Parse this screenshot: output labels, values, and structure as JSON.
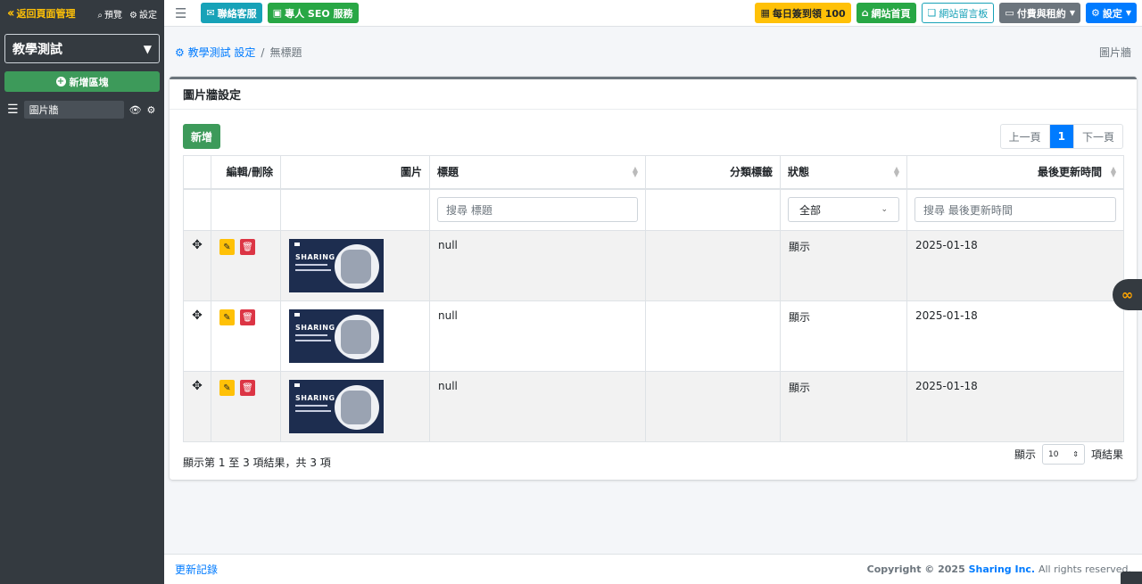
{
  "sidebar": {
    "back_label": "返回頁面管理",
    "preview_label": "預覽",
    "settings_label": "設定",
    "site_select": "教學測試",
    "add_block_label": "新增區塊",
    "items": [
      {
        "label": "圖片牆"
      }
    ]
  },
  "topbar": {
    "contact_label": "聯絡客服",
    "seo_label": "專人 SEO 服務",
    "checkin_label": "每日簽到領 100",
    "home_label": "網站首頁",
    "board_label": "網站留言板",
    "pay_label": "付費與租約",
    "settings_label": "設定"
  },
  "breadcrumb": {
    "root": "教學測試 設定",
    "current": "無標題",
    "right": "圖片牆"
  },
  "card": {
    "title": "圖片牆設定",
    "add_button": "新增",
    "pager": {
      "prev": "上一頁",
      "page": "1",
      "next": "下一頁"
    },
    "columns": [
      "編輯/刪除",
      "圖片",
      "標題",
      "分類標籤",
      "狀態",
      "最後更新時間"
    ],
    "filters": {
      "title_placeholder": "搜尋 標題",
      "status_value": "全部",
      "updated_placeholder": "搜尋 最後更新時間"
    },
    "rows": [
      {
        "image_text": "SHARING",
        "title": "null",
        "tag": "",
        "status": "顯示",
        "updated": "2025-01-18"
      },
      {
        "image_text": "SHARING",
        "title": "null",
        "tag": "",
        "status": "顯示",
        "updated": "2025-01-18"
      },
      {
        "image_text": "SHARING",
        "title": "null",
        "tag": "",
        "status": "顯示",
        "updated": "2025-01-18"
      }
    ],
    "summary": "顯示第 1 至 3 項結果，共 3 項",
    "length_prefix": "顯示",
    "length_value": "10",
    "length_suffix": "項結果"
  },
  "footer": {
    "changelog_label": "更新記錄",
    "copyright_prefix": "Copyright © 2025",
    "brand": "Sharing Inc.",
    "copyright_suffix": "All rights reserved."
  },
  "colors": {
    "accent": "#007bff",
    "success": "#28a745",
    "warning": "#ffc107",
    "danger": "#dc3545",
    "info": "#17a2b8",
    "sidebar": "#343a40"
  }
}
